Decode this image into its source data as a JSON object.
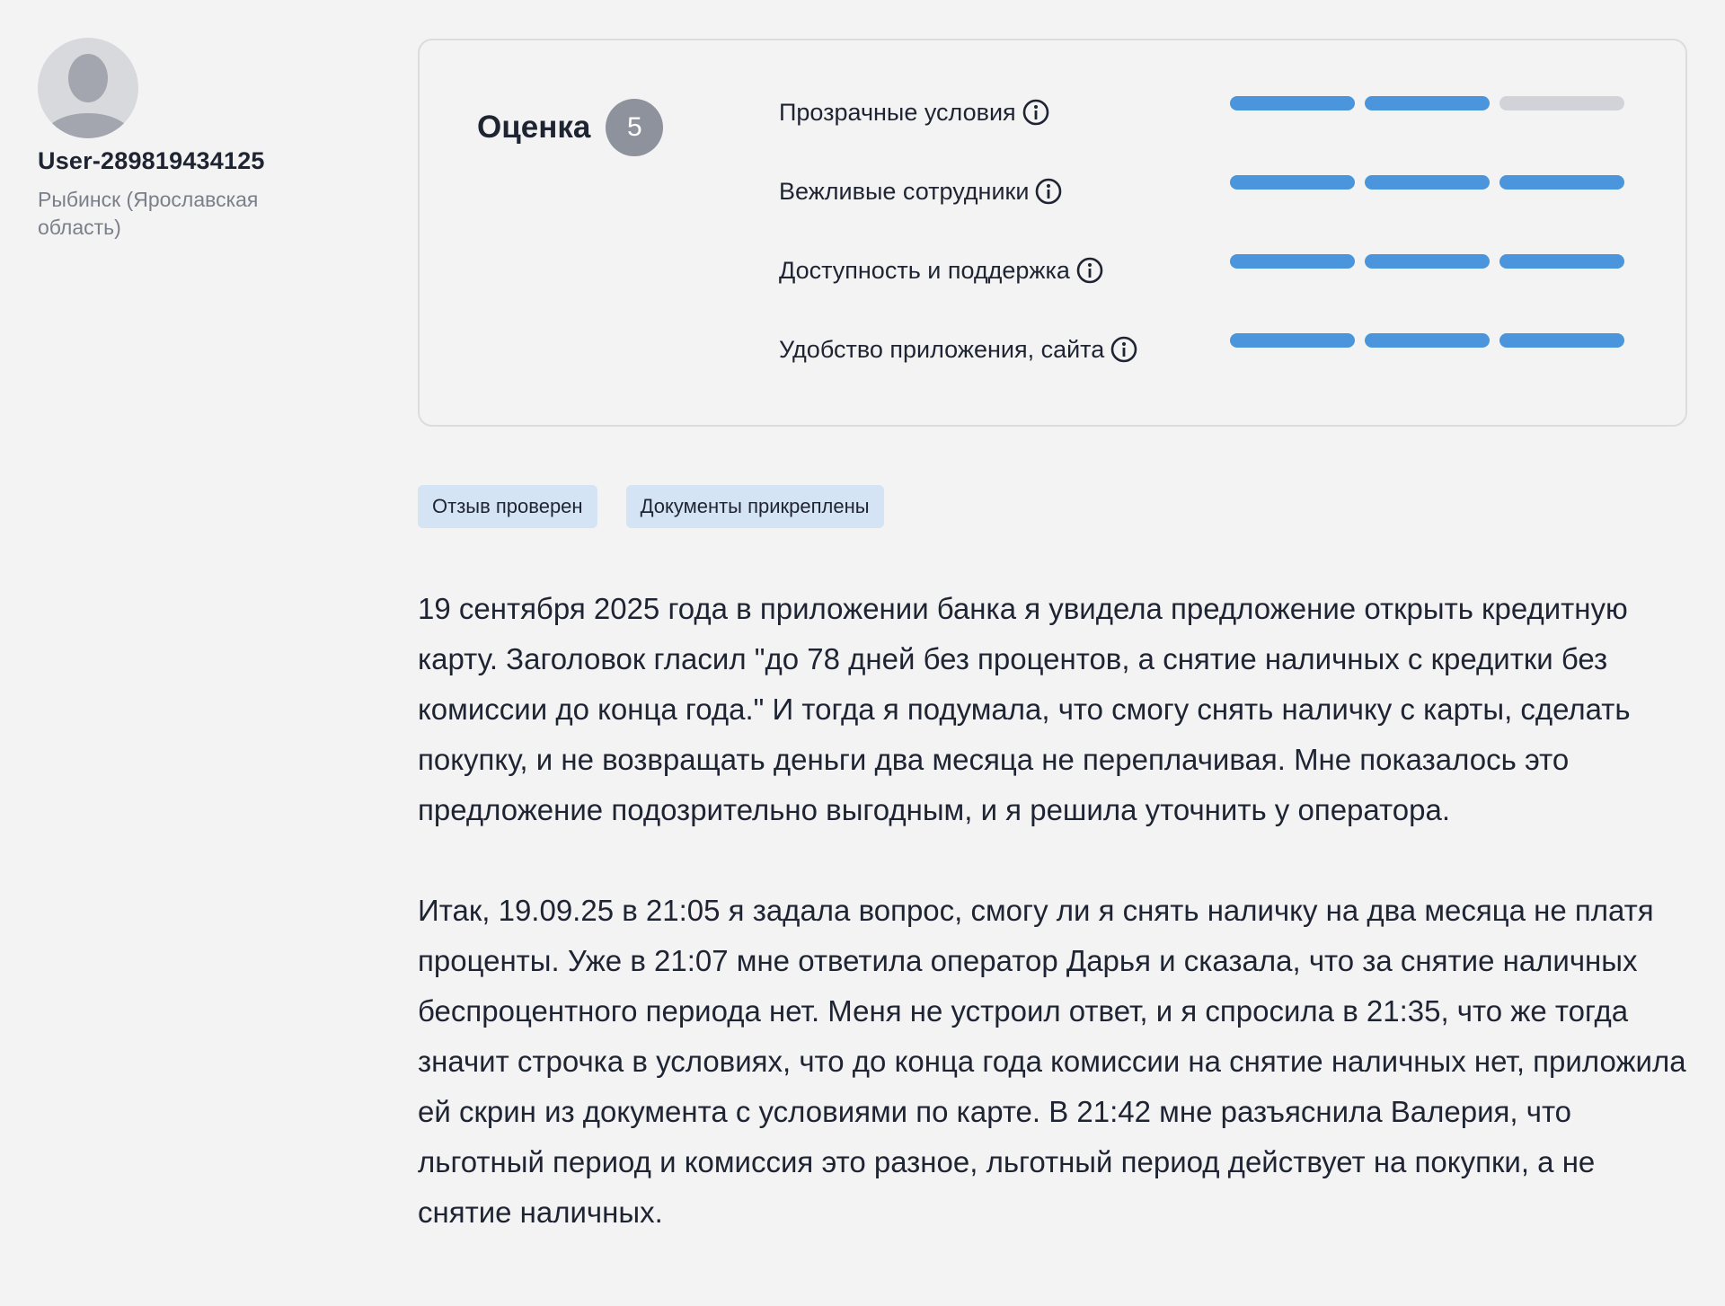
{
  "user": {
    "name": "User-289819434125",
    "location": "Рыбинск (Ярославская область)"
  },
  "rating": {
    "label": "Оценка",
    "score": "5",
    "criteria": [
      {
        "label": "Прозрачные условия",
        "level": 2,
        "max": 3,
        "icon": "info-icon"
      },
      {
        "label": "Вежливые сотрудники",
        "level": 3,
        "max": 3,
        "icon": "info-icon"
      },
      {
        "label": "Доступность и поддержка",
        "level": 3,
        "max": 3,
        "icon": "info-icon"
      },
      {
        "label": "Удобство приложения, сайта",
        "level": 3,
        "max": 3,
        "icon": "info-icon"
      }
    ]
  },
  "badges": [
    "Отзыв проверен",
    "Документы прикреплены"
  ],
  "review": {
    "paragraphs": [
      "19 сентября 2025 года в приложении банка я увидела предложение открыть кредитную карту. Заголовок гласил \"до 78 дней без процентов, а снятие наличных с кредитки без комиссии до конца года.\" И тогда я подумала, что смогу снять наличку с карты, сделать покупку, и не возвращать деньги два месяца не переплачивая. Мне показалось это предложение подозрительно выгодным, и я решила уточнить у оператора.",
      "Итак, 19.09.25 в 21:05 я задала вопрос, смогу ли я снять наличку на два месяца не платя проценты. Уже в 21:07 мне ответила оператор Дарья и сказала, что за снятие наличных беспроцентного периода нет. Меня не устроил ответ, и я спросила в 21:35, что же тогда значит строчка в условиях, что до конца года комиссии на снятие наличных нет, приложила ей скрин из документа с условиями по карте. В 21:42 мне разъяснила Валерия, что льготный период и комиссия это разное, льготный период действует на покупки, а не снятие наличных."
    ]
  },
  "colors": {
    "bar_filled": "#4a95db",
    "bar_empty": "#d2d3d8",
    "badge_bg": "#d5e4f4",
    "score_badge_bg": "#8e929d"
  }
}
